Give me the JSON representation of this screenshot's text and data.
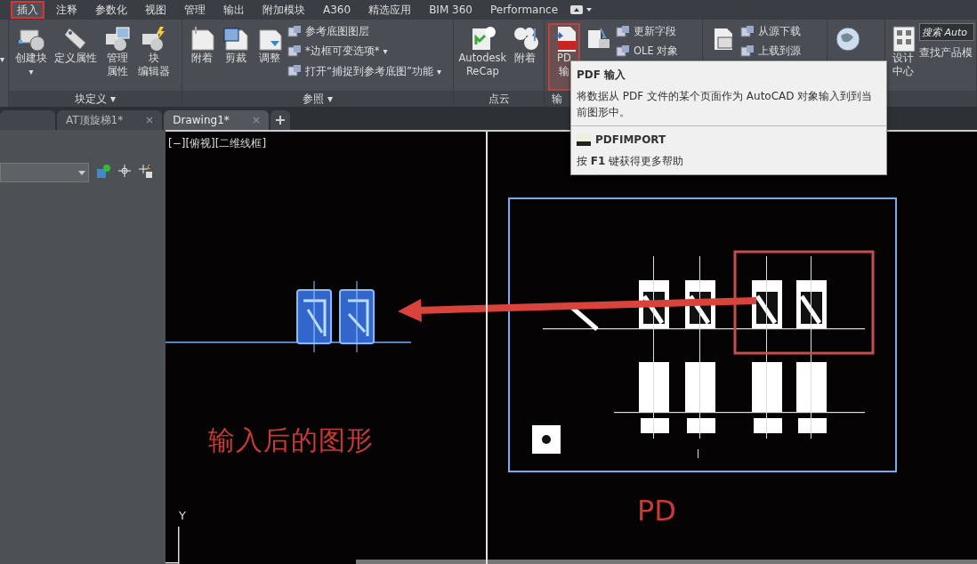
{
  "menu_tabs": [
    {
      "label": "插入",
      "selected": true
    },
    {
      "label": "注释",
      "selected": false
    },
    {
      "label": "参数化",
      "selected": false
    },
    {
      "label": "视图",
      "selected": false
    },
    {
      "label": "管理",
      "selected": false
    },
    {
      "label": "输出",
      "selected": false
    },
    {
      "label": "附加模块",
      "selected": false
    },
    {
      "label": "A360",
      "selected": false
    },
    {
      "label": "精选应用",
      "selected": false
    },
    {
      "label": "BIM 360",
      "selected": false
    },
    {
      "label": "Performance",
      "selected": false
    }
  ],
  "ribbon_left_caret": "▾",
  "ribbon_panels": [
    {
      "label": "块定义",
      "caret": "▾",
      "buttons": [
        {
          "kind": "large",
          "lines": [
            "创建块"
          ],
          "caret": "▾",
          "selected": false
        },
        {
          "kind": "large",
          "lines": [
            "定义属性"
          ],
          "selected": false
        },
        {
          "kind": "large",
          "lines": [
            "管理",
            "属性"
          ],
          "selected": false
        },
        {
          "kind": "large",
          "lines": [
            "块",
            "编辑器"
          ],
          "selected": false
        }
      ]
    },
    {
      "label": "参照",
      "caret": "▾",
      "buttons": [
        {
          "kind": "large",
          "lines": [
            "附着"
          ],
          "selected": false
        },
        {
          "kind": "large",
          "lines": [
            "剪裁"
          ],
          "selected": false
        },
        {
          "kind": "large",
          "lines": [
            "调整"
          ],
          "selected": false
        },
        {
          "kind": "small",
          "label": "参考底图图层"
        },
        {
          "kind": "small",
          "label": "*边框可变选项*",
          "caret": "▾"
        },
        {
          "kind": "small",
          "label": "打开“捕捉到参考底图”功能",
          "caret": "▾"
        }
      ]
    },
    {
      "label": "点云",
      "buttons": [
        {
          "kind": "large",
          "lines": [
            "Autodesk",
            "ReCap"
          ],
          "selected": false
        },
        {
          "kind": "large",
          "lines": [
            "附着"
          ],
          "selected": false
        }
      ]
    },
    {
      "label": "输",
      "buttons": [
        {
          "kind": "large",
          "lines": [
            "PD",
            "输"
          ],
          "selected": true
        },
        {
          "kind": "large",
          "selected": false
        },
        {
          "kind": "small",
          "label": "更新字段"
        },
        {
          "kind": "small",
          "label": "OLE 对象"
        }
      ]
    },
    {
      "buttons": [
        {
          "kind": "large",
          "selected": false
        },
        {
          "kind": "small",
          "label": "从源下载"
        },
        {
          "kind": "small",
          "label": "上载到源"
        }
      ]
    },
    {
      "buttons": [
        {
          "kind": "large",
          "selected": false
        }
      ]
    },
    {
      "buttons": [
        {
          "kind": "large",
          "lines": [
            "设计",
            "中心"
          ],
          "selected": false
        },
        {
          "kind": "search",
          "placeholder": "搜索 Auto",
          "label": "查找产品模"
        }
      ]
    }
  ],
  "doc_tabs": [
    {
      "label": "AT顶旋梯1*",
      "selected": false
    },
    {
      "label": "Drawing1*",
      "selected": true
    }
  ],
  "viewport_label": "[−][俯视][二维线框]",
  "canvas": {
    "annotation": "输入后的图形",
    "partial_label": "PD",
    "ucs_axis": "Y"
  },
  "tooltip": {
    "title": "PDF 输入",
    "description": "将数据从 PDF 文件的某个页面作为 AutoCAD 对象输入到到当前图形中。",
    "command": "PDFIMPORT",
    "help": "按 **F1** 键获得更多帮助"
  }
}
